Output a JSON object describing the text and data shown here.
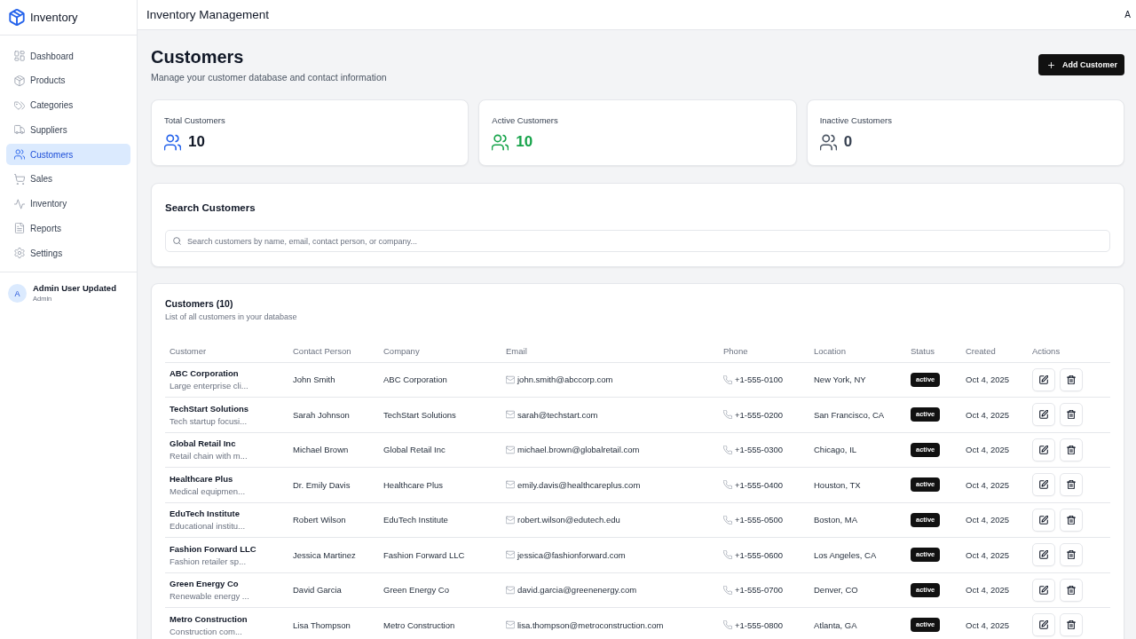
{
  "app": {
    "name": "Inventory"
  },
  "sidebar": {
    "items": [
      {
        "label": "Dashboard",
        "selected": false
      },
      {
        "label": "Products",
        "selected": false
      },
      {
        "label": "Categories",
        "selected": false
      },
      {
        "label": "Suppliers",
        "selected": false
      },
      {
        "label": "Customers",
        "selected": true
      },
      {
        "label": "Sales",
        "selected": false
      },
      {
        "label": "Inventory",
        "selected": false
      },
      {
        "label": "Reports",
        "selected": false
      },
      {
        "label": "Settings",
        "selected": false
      }
    ],
    "user": {
      "initial": "A",
      "name": "Admin User Updated",
      "role": "Admin"
    }
  },
  "header": {
    "title": "Inventory Management",
    "user_initial": "A"
  },
  "page": {
    "title": "Customers",
    "subtitle": "Manage your customer database and contact information",
    "add_button": "Add Customer"
  },
  "stats": [
    {
      "label": "Total Customers",
      "value": "10",
      "kind": "total",
      "color": "#2563eb"
    },
    {
      "label": "Active Customers",
      "value": "10",
      "kind": "active",
      "color": "#16a34a"
    },
    {
      "label": "Inactive Customers",
      "value": "0",
      "kind": "inactive",
      "color": "#4b5563"
    }
  ],
  "search": {
    "title": "Search Customers",
    "placeholder": "Search customers by name, email, contact person, or company..."
  },
  "table": {
    "title": "Customers (10)",
    "subtitle": "List of all customers in your database",
    "columns": [
      "Customer",
      "Contact Person",
      "Company",
      "Email",
      "Phone",
      "Location",
      "Status",
      "Created",
      "Actions"
    ],
    "rows": [
      {
        "customer": "ABC Corporation",
        "description": "Large enterprise cli...",
        "contact_person": "John Smith",
        "company": "ABC Corporation",
        "email": "john.smith@abccorp.com",
        "phone": "+1-555-0100",
        "location": "New York, NY",
        "status": "active",
        "created": "Oct 4, 2025"
      },
      {
        "customer": "TechStart Solutions",
        "description": "Tech startup focusi...",
        "contact_person": "Sarah Johnson",
        "company": "TechStart Solutions",
        "email": "sarah@techstart.com",
        "phone": "+1-555-0200",
        "location": "San Francisco, CA",
        "status": "active",
        "created": "Oct 4, 2025"
      },
      {
        "customer": "Global Retail Inc",
        "description": "Retail chain with m...",
        "contact_person": "Michael Brown",
        "company": "Global Retail Inc",
        "email": "michael.brown@globalretail.com",
        "phone": "+1-555-0300",
        "location": "Chicago, IL",
        "status": "active",
        "created": "Oct 4, 2025"
      },
      {
        "customer": "Healthcare Plus",
        "description": "Medical equipmen...",
        "contact_person": "Dr. Emily Davis",
        "company": "Healthcare Plus",
        "email": "emily.davis@healthcareplus.com",
        "phone": "+1-555-0400",
        "location": "Houston, TX",
        "status": "active",
        "created": "Oct 4, 2025"
      },
      {
        "customer": "EduTech Institute",
        "description": "Educational institu...",
        "contact_person": "Robert Wilson",
        "company": "EduTech Institute",
        "email": "robert.wilson@edutech.edu",
        "phone": "+1-555-0500",
        "location": "Boston, MA",
        "status": "active",
        "created": "Oct 4, 2025"
      },
      {
        "customer": "Fashion Forward LLC",
        "description": "Fashion retailer sp...",
        "contact_person": "Jessica Martinez",
        "company": "Fashion Forward LLC",
        "email": "jessica@fashionforward.com",
        "phone": "+1-555-0600",
        "location": "Los Angeles, CA",
        "status": "active",
        "created": "Oct 4, 2025"
      },
      {
        "customer": "Green Energy Co",
        "description": "Renewable energy ...",
        "contact_person": "David Garcia",
        "company": "Green Energy Co",
        "email": "david.garcia@greenenergy.com",
        "phone": "+1-555-0700",
        "location": "Denver, CO",
        "status": "active",
        "created": "Oct 4, 2025"
      },
      {
        "customer": "Metro Construction",
        "description": "Construction com...",
        "contact_person": "Lisa Thompson",
        "company": "Metro Construction",
        "email": "lisa.thompson@metroconstruction.com",
        "phone": "+1-555-0800",
        "location": "Atlanta, GA",
        "status": "active",
        "created": "Oct 4, 2025"
      }
    ]
  }
}
